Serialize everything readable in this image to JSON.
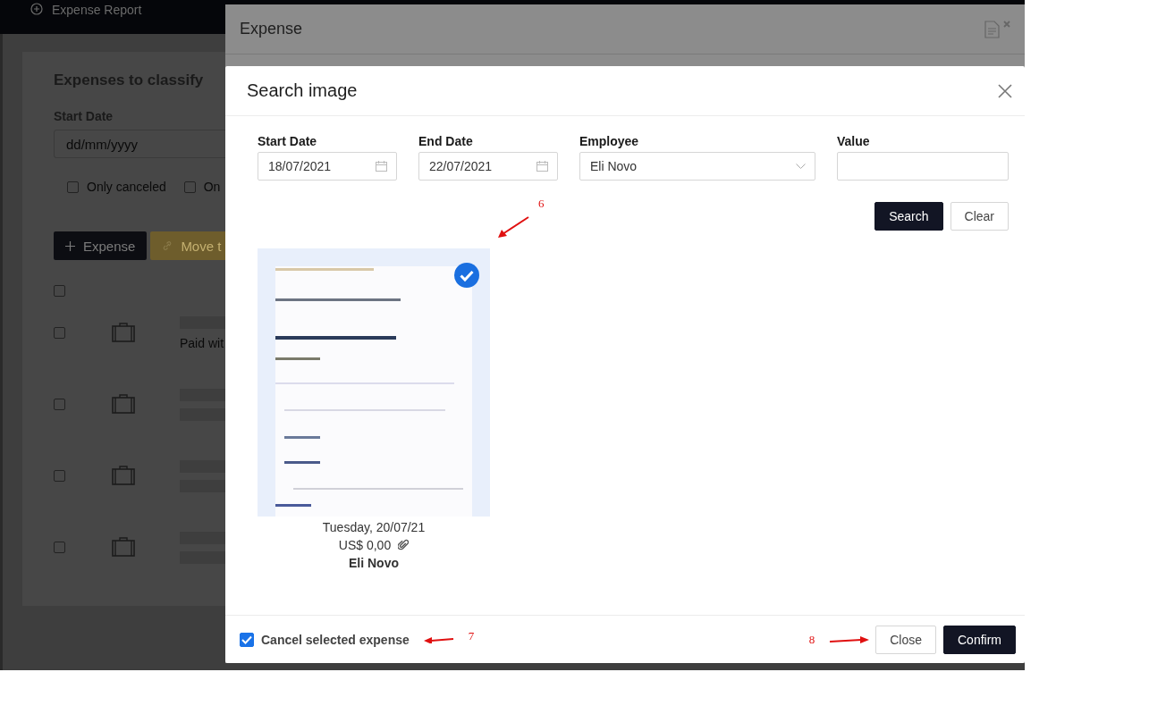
{
  "nav": {
    "title": "Expense Report"
  },
  "background_page": {
    "title": "Expenses to classify",
    "start_date": {
      "label": "Start Date",
      "placeholder": "dd/mm/yyyy"
    },
    "filters": [
      {
        "label": "Only canceled",
        "checked": false
      },
      {
        "label": "On",
        "checked": false
      }
    ],
    "buttons": [
      {
        "label": "Expense",
        "kind": "primary"
      },
      {
        "label": "Move t",
        "kind": "warning"
      }
    ],
    "select_all": {
      "checked": false
    },
    "rows": [
      {
        "checked": false,
        "note": "Paid wit"
      },
      {
        "checked": false
      },
      {
        "checked": false
      },
      {
        "checked": false
      }
    ]
  },
  "expense_dialog": {
    "title": "Expense"
  },
  "search_dialog": {
    "title": "Search image",
    "filters": [
      {
        "label": "Start Date",
        "value": "18/07/2021",
        "kind": "date"
      },
      {
        "label": "End Date",
        "value": "22/07/2021",
        "kind": "date"
      },
      {
        "label": "Employee",
        "value": "Eli Novo",
        "kind": "select"
      },
      {
        "label": "Value",
        "kind": "text"
      }
    ],
    "buttons": [
      {
        "label": "Search",
        "kind": "primary"
      },
      {
        "label": "Clear",
        "kind": "secondary"
      }
    ],
    "results": [
      {
        "selected": true,
        "date": "Tuesday, 20/07/21",
        "amount": "US$ 0,00",
        "attachment": true,
        "employee": "Eli Novo"
      }
    ],
    "cancel_selected": {
      "label": "Cancel selected expense",
      "checked": true
    },
    "footer_buttons": [
      {
        "label": "Close",
        "kind": "secondary"
      },
      {
        "label": "Confirm",
        "kind": "primary"
      }
    ]
  },
  "annotations": [
    "6",
    "7",
    "8"
  ]
}
